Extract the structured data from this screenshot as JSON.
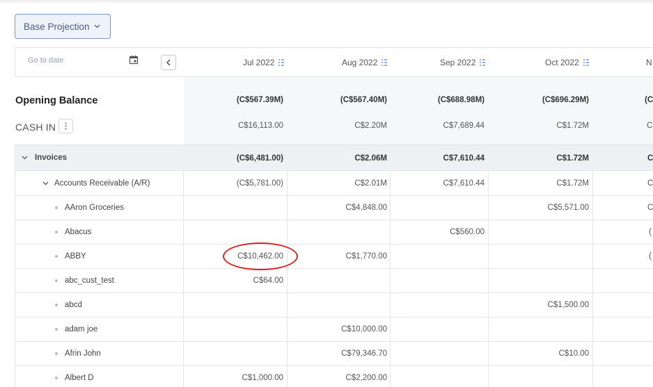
{
  "toolbar": {
    "projection_label": "Base Projection"
  },
  "date_picker": {
    "placeholder": "Go to date"
  },
  "months": [
    "Jul 2022",
    "Aug 2022",
    "Sep 2022",
    "Oct 2022",
    "N"
  ],
  "opening_balance": {
    "label": "Opening Balance",
    "values": [
      "(C$567.39M)",
      "(C$567.40M)",
      "(C$688.98M)",
      "(C$696.29M)",
      "(C"
    ]
  },
  "cash_in": {
    "label": "CASH IN",
    "values": [
      "C$16,113.00",
      "C$2.20M",
      "C$7,689.44",
      "C$1.72M",
      "C:"
    ]
  },
  "rows": [
    {
      "label": "Invoices",
      "type": "group",
      "values": [
        "(C$6,481.00)",
        "C$2.06M",
        "C$7,610.44",
        "C$1.72M",
        "C!"
      ]
    },
    {
      "label": "Accounts Receivable (A/R)",
      "type": "subgroup",
      "values": [
        "(C$5,781.00)",
        "C$2.01M",
        "C$7,610.44",
        "C$1.72M",
        "C!"
      ]
    },
    {
      "label": "AAron Groceries",
      "type": "item",
      "values": [
        "",
        "C$4,848.00",
        "",
        "C$5,571.00",
        "C:"
      ]
    },
    {
      "label": "Abacus",
      "type": "item",
      "values": [
        "",
        "",
        "C$560.00",
        "",
        "("
      ]
    },
    {
      "label": "ABBY",
      "type": "item",
      "values": [
        "C$10,462.00",
        "C$1,770.00",
        "",
        "",
        "("
      ]
    },
    {
      "label": "abc_cust_test",
      "type": "item",
      "values": [
        "C$64.00",
        "",
        "",
        "",
        ""
      ]
    },
    {
      "label": "abcd",
      "type": "item",
      "values": [
        "",
        "",
        "",
        "C$1,500.00",
        ""
      ]
    },
    {
      "label": "adam joe",
      "type": "item",
      "values": [
        "",
        "C$10,000.00",
        "",
        "",
        ""
      ]
    },
    {
      "label": "Afrin John",
      "type": "item",
      "values": [
        "",
        "C$79,346.70",
        "",
        "C$10.00",
        ""
      ]
    },
    {
      "label": "Albert D",
      "type": "item",
      "values": [
        "C$1,000.00",
        "C$2,200.00",
        "",
        "",
        ""
      ]
    }
  ]
}
